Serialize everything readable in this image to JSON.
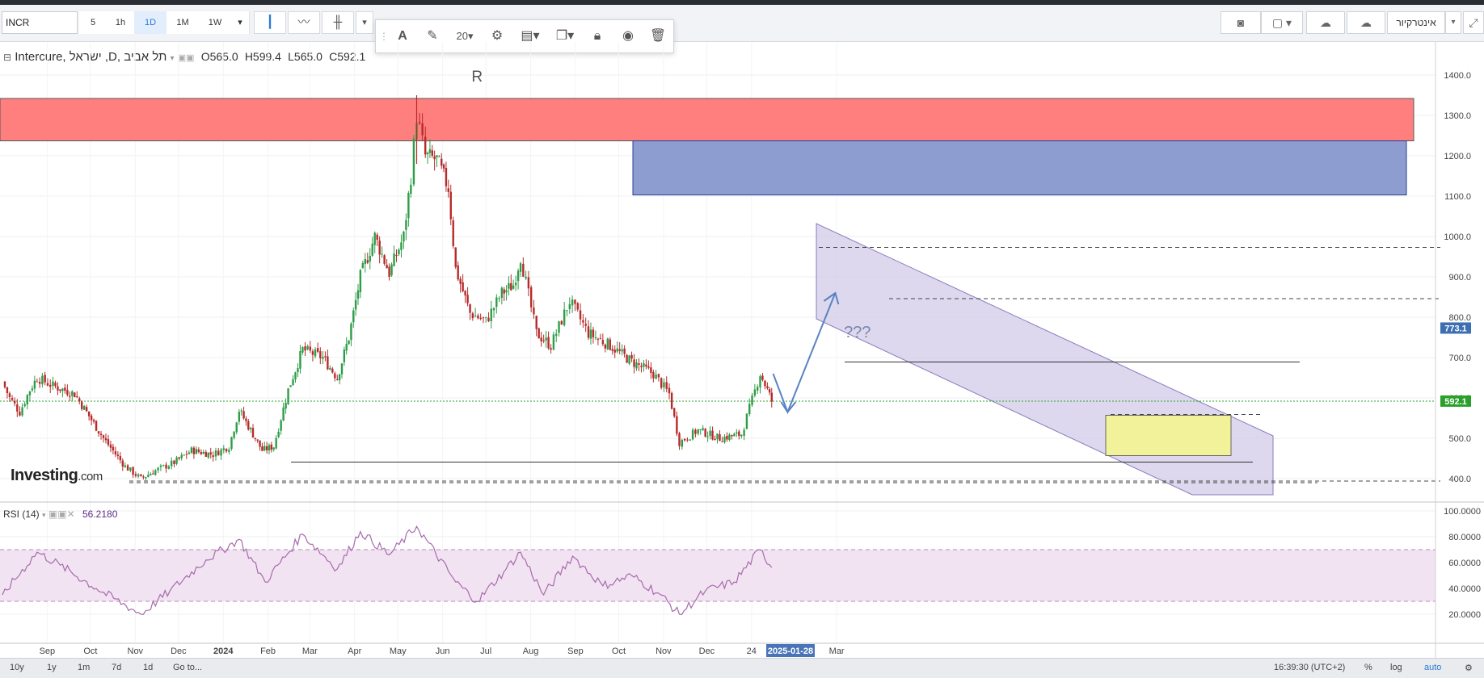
{
  "toolbar": {
    "symbol": "INCR",
    "timeframes": [
      "5",
      "1h",
      "1D",
      "1M",
      "1W"
    ],
    "active_timeframe": "1D",
    "drawing": {
      "font_size": "20"
    },
    "language_button": "אינטרקיור"
  },
  "legend": {
    "name": "Intercure, ישראל ,D, תל אביב",
    "open": "O565.0",
    "high": "H599.4",
    "low": "L565.0",
    "close": "C592.1"
  },
  "rsi_panel": {
    "label": "RSI (14)",
    "value": "56.2180"
  },
  "bottom": {
    "ranges": [
      "10y",
      "1y",
      "1m",
      "7d",
      "1d"
    ],
    "goto": "Go to...",
    "time": "16:39:30 (UTC+2)",
    "pct": "%",
    "log": "log",
    "auto": "auto"
  },
  "annotations": {
    "r_label": "R",
    "question": "???"
  },
  "colors": {
    "up": "#2e9d48",
    "down": "#b72a2a",
    "resistance_zone": "#ff7f7f",
    "supply_zone": "#8898cc",
    "channel": "#cfc8e6",
    "demand_box": "#f2f29a",
    "rsi_line": "#a86aad",
    "rsi_band": "#f1e3f1",
    "current_price": "#2aa02a",
    "arrow": "#5a82c2"
  },
  "chart_data": [
    {
      "type": "candlestick",
      "title": "Intercure, ישראל ,D, תל אביב",
      "x_tick_labels": [
        "Sep",
        "Oct",
        "Nov",
        "Dec",
        "2024",
        "Feb",
        "Mar",
        "Apr",
        "May",
        "Jun",
        "Jul",
        "Aug",
        "Sep",
        "Oct",
        "Nov",
        "Dec",
        "24",
        "2025-01-28",
        "Mar"
      ],
      "y_ticks": [
        400,
        500,
        600,
        700,
        800,
        900,
        1000,
        1100,
        1200,
        1300,
        1400
      ],
      "ylim": [
        330,
        1445
      ],
      "price_tags": [
        {
          "label": "773.1",
          "value": 773.1
        },
        {
          "label": "592.1",
          "value": 592.1
        }
      ],
      "waypoints": [
        {
          "date": "2023-08-01",
          "close": 640
        },
        {
          "date": "2023-08-06",
          "close": 600
        },
        {
          "date": "2023-08-13",
          "close": 565
        },
        {
          "date": "2023-08-20",
          "close": 620
        },
        {
          "date": "2023-08-25",
          "close": 650
        },
        {
          "date": "2023-09-05",
          "close": 630
        },
        {
          "date": "2023-09-20",
          "close": 610
        },
        {
          "date": "2023-10-10",
          "close": 500
        },
        {
          "date": "2023-10-25",
          "close": 430
        },
        {
          "date": "2023-11-05",
          "close": 400
        },
        {
          "date": "2023-11-15",
          "close": 420
        },
        {
          "date": "2023-11-28",
          "close": 440
        },
        {
          "date": "2023-12-10",
          "close": 470
        },
        {
          "date": "2023-12-25",
          "close": 460
        },
        {
          "date": "2024-01-05",
          "close": 480
        },
        {
          "date": "2024-01-12",
          "close": 570
        },
        {
          "date": "2024-01-20",
          "close": 520
        },
        {
          "date": "2024-01-28",
          "close": 470
        },
        {
          "date": "2024-02-05",
          "close": 480
        },
        {
          "date": "2024-02-15",
          "close": 620
        },
        {
          "date": "2024-02-25",
          "close": 720
        },
        {
          "date": "2024-03-10",
          "close": 700
        },
        {
          "date": "2024-03-20",
          "close": 650
        },
        {
          "date": "2024-03-28",
          "close": 750
        },
        {
          "date": "2024-04-05",
          "close": 900
        },
        {
          "date": "2024-04-15",
          "close": 1000
        },
        {
          "date": "2024-04-25",
          "close": 910
        },
        {
          "date": "2024-05-05",
          "close": 1000
        },
        {
          "date": "2024-05-10",
          "close": 1150
        },
        {
          "date": "2024-05-14",
          "close": 1300
        },
        {
          "date": "2024-05-20",
          "close": 1200
        },
        {
          "date": "2024-05-28",
          "close": 1190
        },
        {
          "date": "2024-06-05",
          "close": 1120
        },
        {
          "date": "2024-06-10",
          "close": 920
        },
        {
          "date": "2024-06-20",
          "close": 810
        },
        {
          "date": "2024-07-01",
          "close": 790
        },
        {
          "date": "2024-07-12",
          "close": 860
        },
        {
          "date": "2024-07-20",
          "close": 880
        },
        {
          "date": "2024-07-25",
          "close": 950
        },
        {
          "date": "2024-08-05",
          "close": 760
        },
        {
          "date": "2024-08-15",
          "close": 730
        },
        {
          "date": "2024-08-28",
          "close": 840
        },
        {
          "date": "2024-09-10",
          "close": 760
        },
        {
          "date": "2024-09-25",
          "close": 730
        },
        {
          "date": "2024-10-10",
          "close": 690
        },
        {
          "date": "2024-10-25",
          "close": 660
        },
        {
          "date": "2024-11-05",
          "close": 610
        },
        {
          "date": "2024-11-12",
          "close": 490
        },
        {
          "date": "2024-11-25",
          "close": 520
        },
        {
          "date": "2024-12-10",
          "close": 500
        },
        {
          "date": "2024-12-25",
          "close": 510
        },
        {
          "date": "2025-01-07",
          "close": 660
        },
        {
          "date": "2025-01-12",
          "close": 620
        },
        {
          "date": "2025-01-15",
          "close": 592
        }
      ]
    },
    {
      "type": "line",
      "title": "RSI (14)",
      "y_ticks": [
        20,
        40,
        60,
        80,
        100
      ],
      "ylim": [
        0,
        102
      ],
      "bands": [
        30,
        70
      ],
      "last_value": 56.218,
      "waypoints": [
        {
          "date": "2023-08-01",
          "value": 35
        },
        {
          "date": "2023-08-25",
          "value": 68
        },
        {
          "date": "2023-09-10",
          "value": 58
        },
        {
          "date": "2023-10-05",
          "value": 40
        },
        {
          "date": "2023-11-05",
          "value": 20
        },
        {
          "date": "2023-11-25",
          "value": 38
        },
        {
          "date": "2023-12-20",
          "value": 62
        },
        {
          "date": "2024-01-12",
          "value": 78
        },
        {
          "date": "2024-01-30",
          "value": 45
        },
        {
          "date": "2024-02-25",
          "value": 82
        },
        {
          "date": "2024-03-20",
          "value": 55
        },
        {
          "date": "2024-04-05",
          "value": 84
        },
        {
          "date": "2024-04-25",
          "value": 66
        },
        {
          "date": "2024-05-14",
          "value": 88
        },
        {
          "date": "2024-06-10",
          "value": 45
        },
        {
          "date": "2024-06-25",
          "value": 30
        },
        {
          "date": "2024-07-15",
          "value": 55
        },
        {
          "date": "2024-07-25",
          "value": 68
        },
        {
          "date": "2024-08-10",
          "value": 35
        },
        {
          "date": "2024-08-30",
          "value": 65
        },
        {
          "date": "2024-09-20",
          "value": 42
        },
        {
          "date": "2024-10-10",
          "value": 50
        },
        {
          "date": "2024-10-30",
          "value": 35
        },
        {
          "date": "2024-11-12",
          "value": 20
        },
        {
          "date": "2024-11-30",
          "value": 38
        },
        {
          "date": "2024-12-20",
          "value": 45
        },
        {
          "date": "2025-01-07",
          "value": 70
        },
        {
          "date": "2025-01-15",
          "value": 56.2
        }
      ]
    }
  ]
}
